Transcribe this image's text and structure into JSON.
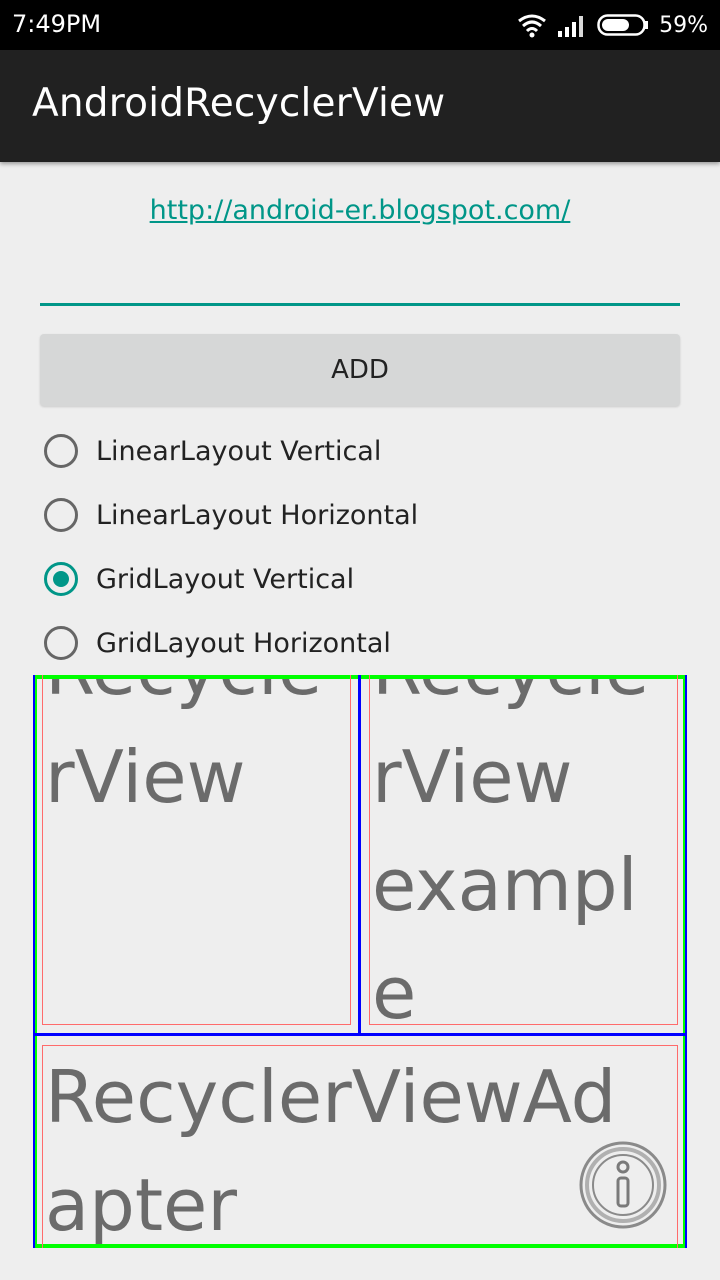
{
  "status_bar": {
    "time": "7:49PM",
    "battery": "59%",
    "icons": [
      "wifi-icon",
      "signal-icon",
      "battery-icon"
    ]
  },
  "app_bar": {
    "title": "AndroidRecyclerView"
  },
  "link": {
    "text": "http://android-er.blogspot.com/"
  },
  "input": {
    "value": ""
  },
  "add_button": {
    "label": "ADD"
  },
  "layout_options": [
    {
      "label": "LinearLayout Vertical",
      "checked": false
    },
    {
      "label": "LinearLayout Horizontal",
      "checked": false
    },
    {
      "label": "GridLayout Vertical",
      "checked": true
    },
    {
      "label": "GridLayout Horizontal",
      "checked": false
    }
  ],
  "recycler_items": [
    {
      "lines": [
        "Recycle",
        "rView"
      ]
    },
    {
      "lines": [
        "Recycle",
        "rView",
        "exampl",
        "e"
      ]
    },
    {
      "lines": [
        "RecyclerViewAd",
        "apter"
      ]
    }
  ],
  "colors": {
    "accent": "#009688",
    "appbar": "#212121",
    "item_text": "#6b6b6b",
    "frame_green": "#00ff00",
    "frame_blue": "#0000ff",
    "frame_red": "#ff6b6b"
  },
  "fab": {
    "icon": "info-icon"
  }
}
